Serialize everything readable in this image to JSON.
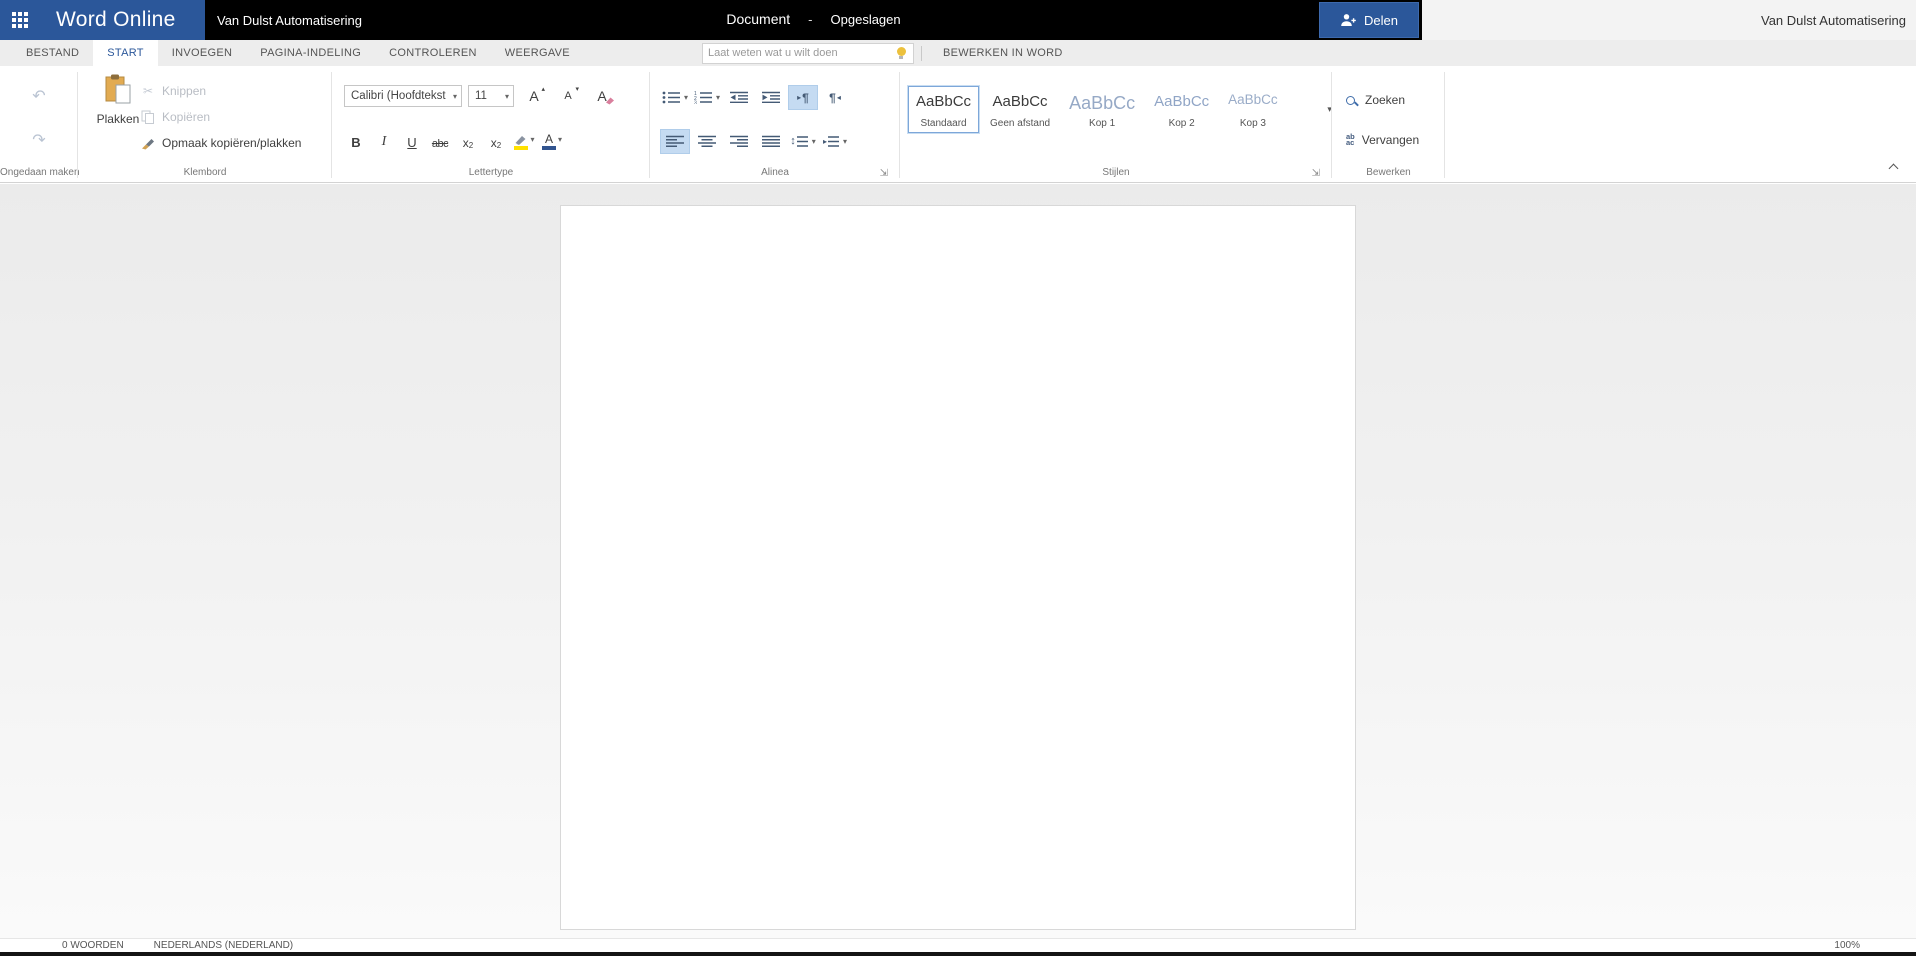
{
  "topbar": {
    "app_name": "Word Online",
    "org_name": "Van Dulst Automatisering",
    "doc_title": "Document",
    "separator": "-",
    "save_status": "Opgeslagen",
    "share_label": "Delen",
    "account_name": "Van Dulst Automatisering"
  },
  "tabs": {
    "items": [
      "BESTAND",
      "START",
      "INVOEGEN",
      "PAGINA-INDELING",
      "CONTROLEREN",
      "WEERGAVE"
    ],
    "active": "START",
    "search_placeholder": "Laat weten wat u wilt doen",
    "edit_in_word": "BEWERKEN IN WORD"
  },
  "ribbon": {
    "undo_group": {
      "label": "Ongedaan maken"
    },
    "clipboard_group": {
      "label": "Klembord",
      "paste": "Plakken",
      "cut": "Knippen",
      "copy": "Kopiëren",
      "format_painter": "Opmaak kopiëren/plakken"
    },
    "font_group": {
      "label": "Lettertype",
      "font_name": "Calibri (Hoofdtekst",
      "font_size": "11",
      "bold": "B",
      "italic": "I",
      "underline": "U",
      "strikethrough": "abc",
      "sub_base": "x",
      "sub_mark": "2",
      "sup_base": "x",
      "sup_mark": "2"
    },
    "paragraph_group": {
      "label": "Alinea"
    },
    "styles_group": {
      "label": "Stijlen",
      "styles": [
        {
          "preview": "AaBbCc",
          "name": "Standaard"
        },
        {
          "preview": "AaBbCc",
          "name": "Geen afstand"
        },
        {
          "preview": "AaBbCc",
          "name": "Kop 1"
        },
        {
          "preview": "AaBbCc",
          "name": "Kop 2"
        },
        {
          "preview": "AaBbCc",
          "name": "Kop 3"
        }
      ]
    },
    "editing_group": {
      "label": "Bewerken",
      "find": "Zoeken",
      "replace": "Vervangen"
    }
  },
  "statusbar": {
    "word_count": "0 WOORDEN",
    "language": "NEDERLANDS (NEDERLAND)",
    "zoom_level": "100%"
  },
  "icons": {
    "undo": "↶",
    "redo": "↷",
    "caret": "▾",
    "grow_caret": "▴",
    "scissors": "✂",
    "pilcrow": "¶",
    "tri_right": "▸",
    "tri_left": "◂",
    "updown": "↕",
    "dialog_launcher": "⇲",
    "letter_a": "A",
    "replace_top": "ab",
    "replace_bottom": "ac"
  },
  "colors": {
    "brand_blue": "#2b579a",
    "topbar_black": "#000000",
    "active_toggle": "#c5dbf2",
    "selected_style_border": "#7da7d9",
    "highlight_yellow": "#ffe100",
    "font_color_bar": "#31548f",
    "heading_preview": "#96a9c6"
  }
}
